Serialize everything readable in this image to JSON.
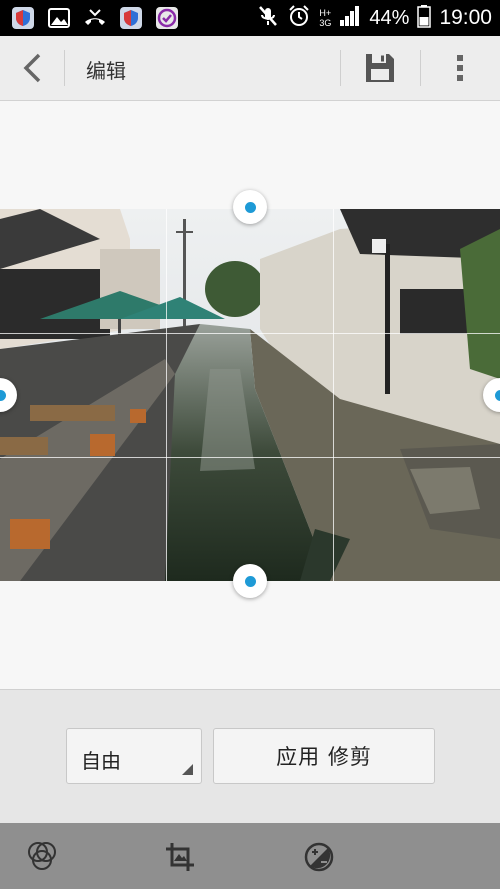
{
  "status_bar": {
    "network": "H+",
    "network_3g": "3G",
    "battery_pct": "44%",
    "time": "19:00",
    "icons": [
      "shield-app-icon",
      "gallery-icon",
      "missed-call-icon",
      "shield-app-icon",
      "purple-app-icon",
      "mute-icon",
      "alarm-icon",
      "signal-icon",
      "battery-icon"
    ]
  },
  "action_bar": {
    "title": "编辑",
    "icons": [
      "back-icon",
      "save-icon",
      "more-icon"
    ]
  },
  "crop": {
    "aspect_ratio_label": "自由",
    "apply_label": "应用 修剪"
  },
  "toolbar": {
    "icons": [
      "filters-icon",
      "crop-icon",
      "exposure-icon"
    ],
    "active": "crop-icon"
  },
  "colors": {
    "accent": "#1e9ad6",
    "status_bar": "#000000",
    "toolbar": "#8f8f8f"
  }
}
